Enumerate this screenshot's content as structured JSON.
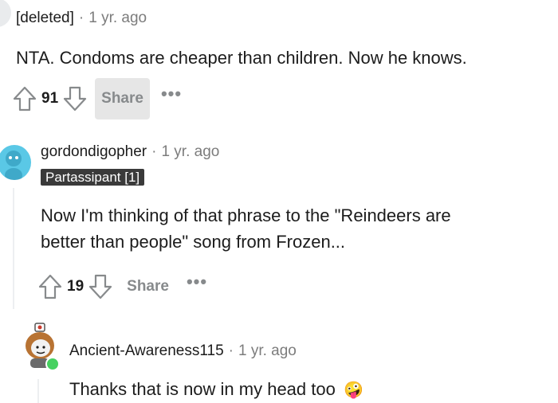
{
  "comments": [
    {
      "username": "[deleted]",
      "time": "1 yr. ago",
      "text": "NTA. Condoms are cheaper than children. Now he knows.",
      "score": "91",
      "share_label": "Share",
      "more_label": "•••"
    },
    {
      "username": "gordondigopher",
      "time": "1 yr. ago",
      "flair": "Partassipant [1]",
      "text_line1": "Now I'm thinking of that phrase to the \"Reindeers are",
      "text_line2": "better than people\" song from Frozen...",
      "score": "19",
      "share_label": "Share",
      "more_label": "•••"
    },
    {
      "username": "Ancient-Awareness115",
      "time": "1 yr. ago",
      "text": "Thanks that is now in my head too",
      "emoji": "🤪"
    }
  ],
  "separator": "·",
  "colors": {
    "vote_icon": "#878a8c",
    "meta_gray": "#7c7c7c",
    "flair_bg": "#3a3a3a",
    "avatar_teal": "#5ac8e6",
    "online_green": "#46d160",
    "share_hover_bg": "#e6e6e6"
  }
}
